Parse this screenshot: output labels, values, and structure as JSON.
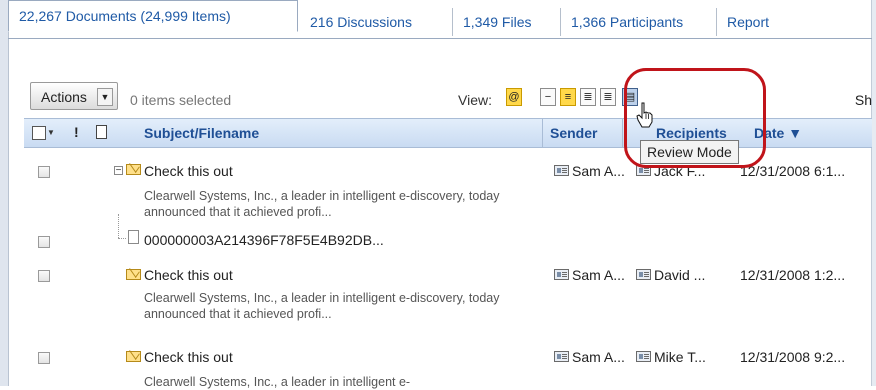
{
  "tabs": [
    {
      "label": "22,267 Documents (24,999 Items)",
      "active": true
    },
    {
      "label": "216 Discussions"
    },
    {
      "label": "1,349 Files"
    },
    {
      "label": "1,366 Participants"
    },
    {
      "label": "Report"
    }
  ],
  "toolbar": {
    "actions_label": "Actions",
    "items_selected": "0 items selected",
    "view_label": "View:",
    "sh_label": "Sh",
    "view_icons": [
      "attachment-view-icon",
      "list-view-icon",
      "detail-view-icon",
      "full-view-icon",
      "review-mode-icon"
    ]
  },
  "columns": {
    "flag": "!",
    "subject": "Subject/Filename",
    "sender": "Sender",
    "recipients": "Recipients",
    "date": "Date ▼"
  },
  "tooltip": "Review Mode",
  "rows": [
    {
      "subject": "Check this out",
      "snippet": "Clearwell Systems, Inc., a leader in intelligent e-discovery, today announced that it achieved profi...",
      "sender": "Sam A...",
      "recipient": "Jack F...",
      "date": "12/31/2008 6:1...",
      "attachment": "000000003A214396F78F5E4B92DB..."
    },
    {
      "subject": "Check this out",
      "snippet": "Clearwell Systems, Inc., a leader in intelligent e-discovery, today announced that it achieved profi...",
      "sender": "Sam A...",
      "recipient": "David ...",
      "date": "12/31/2008 1:2..."
    },
    {
      "subject": "Check this out",
      "snippet": "Clearwell Systems, Inc., a leader in intelligent e-",
      "sender": "Sam A...",
      "recipient": "Mike T...",
      "date": "12/31/2008 9:2..."
    }
  ]
}
